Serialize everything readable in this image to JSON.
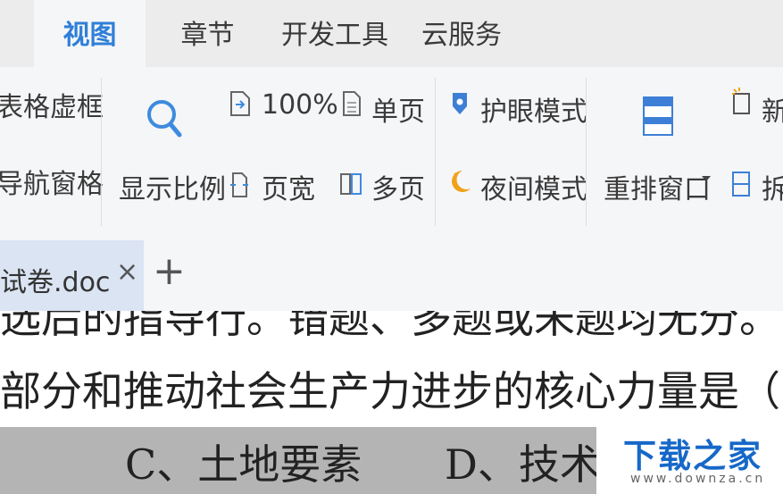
{
  "menu": {
    "tabs": [
      {
        "label": "视图",
        "active": true
      },
      {
        "label": "章节",
        "active": false
      },
      {
        "label": "开发工具",
        "active": false
      },
      {
        "label": "云服务",
        "active": false
      }
    ]
  },
  "ribbon": {
    "table_frame_label": "表格虚框",
    "nav_pane_label": "导航窗格",
    "zoom_label": "显示比例",
    "zoom_100_label": "100%",
    "single_page_label": "单页",
    "page_width_label": "页宽",
    "multi_page_label": "多页",
    "eye_mode_label": "护眼模式",
    "night_mode_label": "夜间模式",
    "rearrange_label": "重排窗口",
    "new_window_label": "新",
    "split_label": "拆",
    "accent_color": "#2f7fd8",
    "night_icon_color": "#f0a21b"
  },
  "tabs": {
    "doc_tab_label": "试卷.doc",
    "close_glyph": "×",
    "add_glyph": "+"
  },
  "document": {
    "line1": "选后的指导行。错题、多题或未题均无分。",
    "line2": "部分和推动社会生产力进步的核心力量是（",
    "line3_c": "C、土地要素",
    "line3_d": "D、技术要素"
  },
  "watermark": {
    "title": "下载之家",
    "url": "www.downza.cn"
  }
}
